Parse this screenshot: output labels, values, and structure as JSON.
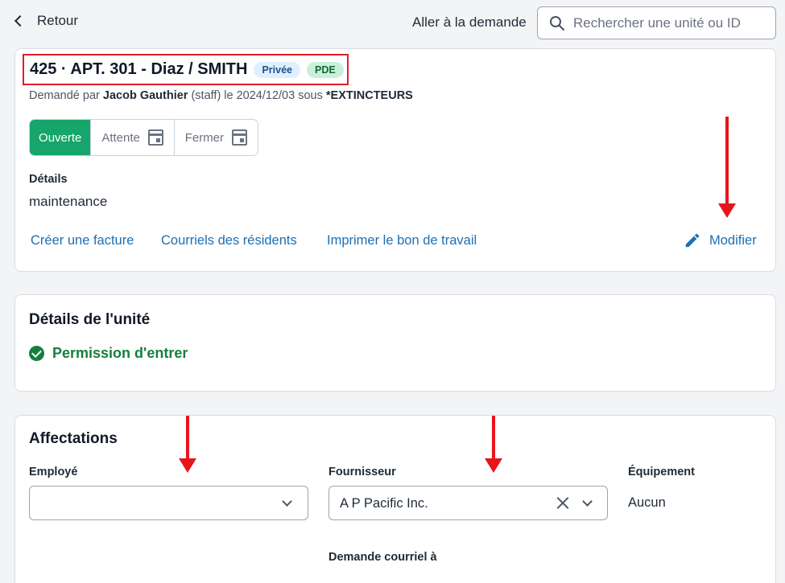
{
  "topbar": {
    "back_label": "Retour",
    "goto_label": "Aller à la demande",
    "search_placeholder": "Rechercher une unité ou ID"
  },
  "request": {
    "title": "425 · APT. 301 - Diaz / SMITH",
    "badges": [
      "Privée",
      "PDE"
    ],
    "subtitle": {
      "prefix": "Demandé par ",
      "requester": "Jacob Gauthier",
      "middle": " (staff) le 2024/12/03 sous ",
      "category": "*EXTINCTEURS"
    },
    "status": {
      "options": [
        "Ouverte",
        "Attente",
        "Fermer"
      ],
      "selected": "Ouverte"
    },
    "details_label": "Détails",
    "details_value": "maintenance",
    "links": [
      "Créer une facture",
      "Courriels des résidents",
      "Imprimer le bon de travail"
    ],
    "modify_label": "Modifier"
  },
  "unit_details": {
    "heading": "Détails de l'unité",
    "permission": "Permission d'entrer"
  },
  "assignments": {
    "heading": "Affectations",
    "employee_label": "Employé",
    "employee_value": "",
    "supplier_label": "Fournisseur",
    "supplier_value": "A P Pacific Inc.",
    "equipment_label": "Équipement",
    "equipment_value": "Aucun",
    "email_label": "Demande courriel à"
  },
  "colors": {
    "primary_link": "#1b6fb5",
    "open_status": "#16a56a",
    "permission_green": "#15803d",
    "annotation_red": "#e8141c"
  }
}
